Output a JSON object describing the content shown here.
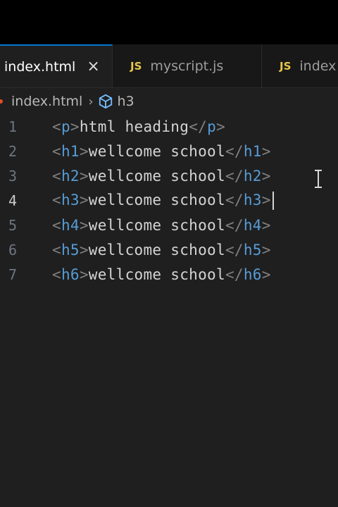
{
  "tabs": [
    {
      "label": "index.html",
      "active": true,
      "close_icon": "×"
    },
    {
      "label": "myscript.js",
      "badge": "JS"
    },
    {
      "label": "index",
      "badge": "JS"
    }
  ],
  "breadcrumb": {
    "file": "index.html",
    "symbol": "h3"
  },
  "editor": {
    "current_line": 4,
    "lines": [
      {
        "n": "1",
        "open": "p",
        "text": "html heading",
        "close": "p"
      },
      {
        "n": "2",
        "open": "h1",
        "text": "wellcome school",
        "close": "h1"
      },
      {
        "n": "3",
        "open": "h2",
        "text": "wellcome school",
        "close": "h2"
      },
      {
        "n": "4",
        "open": "h3",
        "text": "wellcome school",
        "close": "h3"
      },
      {
        "n": "5",
        "open": "h4",
        "text": "wellcome school",
        "close": "h4"
      },
      {
        "n": "6",
        "open": "h5",
        "text": "wellcome school",
        "close": "h5"
      },
      {
        "n": "7",
        "open": "h6",
        "text": "wellcome school",
        "close": "h6"
      }
    ]
  },
  "colors": {
    "accent": "#0078d4",
    "tag": "#569cd6",
    "bracket": "#808080",
    "text": "#d4d4d4",
    "js_badge": "#e6c84c"
  }
}
